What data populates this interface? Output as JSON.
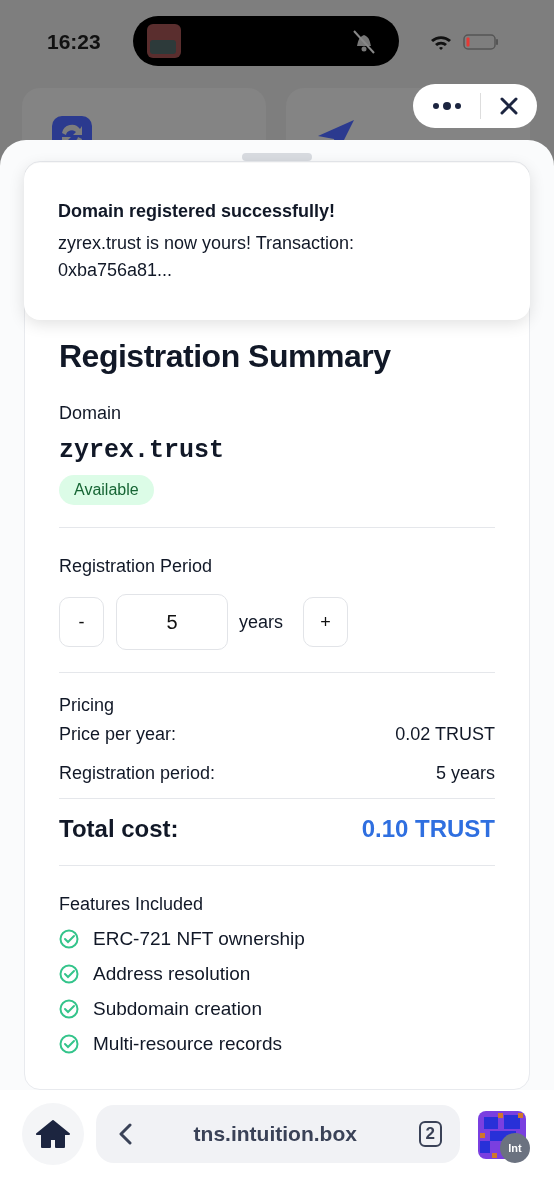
{
  "status_bar": {
    "time": "16:23"
  },
  "toast": {
    "title": "Domain registered successfully!",
    "message": "zyrex.trust is now yours! Transaction: 0xba756a81..."
  },
  "summary": {
    "title": "Registration Summary",
    "domain_label": "Domain",
    "domain": "zyrex.trust",
    "badge": "Available",
    "period_label": "Registration Period",
    "period": {
      "decrement": "-",
      "value": "5",
      "unit": "years",
      "increment": "+"
    },
    "pricing": {
      "title": "Pricing",
      "rows": [
        {
          "label": "Price per year:",
          "value": "0.02 TRUST"
        },
        {
          "label": "Registration period:",
          "value": "5 years"
        }
      ]
    },
    "total": {
      "label": "Total cost:",
      "value": "0.10 TRUST"
    },
    "features": {
      "title": "Features Included",
      "items": [
        "ERC-721 NFT ownership",
        "Address resolution",
        "Subdomain creation",
        "Multi-resource records"
      ]
    }
  },
  "address_bar": {
    "url": "tns.intuition.box",
    "tab_count": "2",
    "badge": "Int"
  }
}
